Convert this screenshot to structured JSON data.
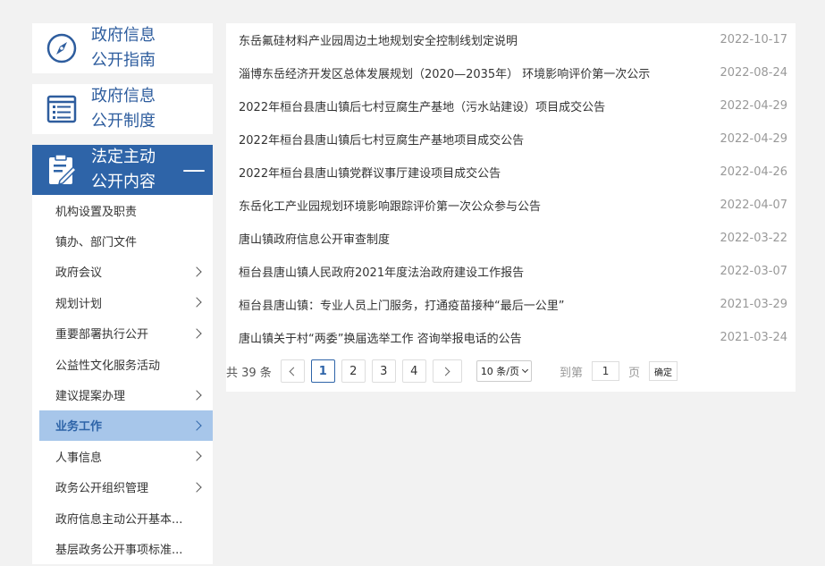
{
  "sidebar": {
    "heads": [
      {
        "line1": "政府信息",
        "line2": "公开指南",
        "icon": "compass-icon"
      },
      {
        "line1": "政府信息",
        "line2": "公开制度",
        "icon": "list-icon"
      },
      {
        "line1": "法定主动",
        "line2": "公开内容",
        "icon": "clipboard-icon",
        "toggle": "—"
      }
    ],
    "items": [
      {
        "label": "机构设置及职责",
        "chevron": false
      },
      {
        "label": "镇办、部门文件",
        "chevron": false
      },
      {
        "label": "政府会议",
        "chevron": true
      },
      {
        "label": "规划计划",
        "chevron": true
      },
      {
        "label": "重要部署执行公开",
        "chevron": true
      },
      {
        "label": "公益性文化服务活动",
        "chevron": false
      },
      {
        "label": "建议提案办理",
        "chevron": true
      },
      {
        "label": "业务工作",
        "chevron": true,
        "selected": true
      },
      {
        "label": "人事信息",
        "chevron": true
      },
      {
        "label": "政务公开组织管理",
        "chevron": true
      },
      {
        "label": "政府信息主动公开基本...",
        "chevron": false
      },
      {
        "label": "基层政务公开事项标准...",
        "chevron": false
      }
    ]
  },
  "list": [
    {
      "title": "东岳氟硅材料产业园周边土地规划安全控制线划定说明",
      "date": "2022-10-17"
    },
    {
      "title": "淄博东岳经济开发区总体发展规划（2020—2035年） 环境影响评价第一次公示",
      "date": "2022-08-24"
    },
    {
      "title": "2022年桓台县唐山镇后七村豆腐生产基地（污水站建设）项目成交公告",
      "date": "2022-04-29"
    },
    {
      "title": "2022年桓台县唐山镇后七村豆腐生产基地项目成交公告",
      "date": "2022-04-29"
    },
    {
      "title": "2022年桓台县唐山镇党群议事厅建设项目成交公告",
      "date": "2022-04-26"
    },
    {
      "title": "东岳化工产业园规划环境影响跟踪评价第一次公众参与公告",
      "date": "2022-04-07"
    },
    {
      "title": "唐山镇政府信息公开审查制度",
      "date": "2022-03-22"
    },
    {
      "title": "桓台县唐山镇人民政府2021年度法治政府建设工作报告",
      "date": "2022-03-07"
    },
    {
      "title": "桓台县唐山镇：专业人员上门服务，打通疫苗接种“最后一公里”",
      "date": "2021-03-29"
    },
    {
      "title": "唐山镇关于村“两委”换届选举工作 咨询举报电话的公告",
      "date": "2021-03-24"
    }
  ],
  "pager": {
    "total": "共 39 条",
    "pages": [
      "1",
      "2",
      "3",
      "4"
    ],
    "current": "1",
    "page_size": "10 条/页",
    "goto_label": "到第",
    "goto_value": "1",
    "page_unit": "页",
    "confirm": "确定"
  },
  "colors": {
    "accent": "#2e64a8",
    "selected_bg": "#a7c6ea",
    "date": "#999999"
  }
}
